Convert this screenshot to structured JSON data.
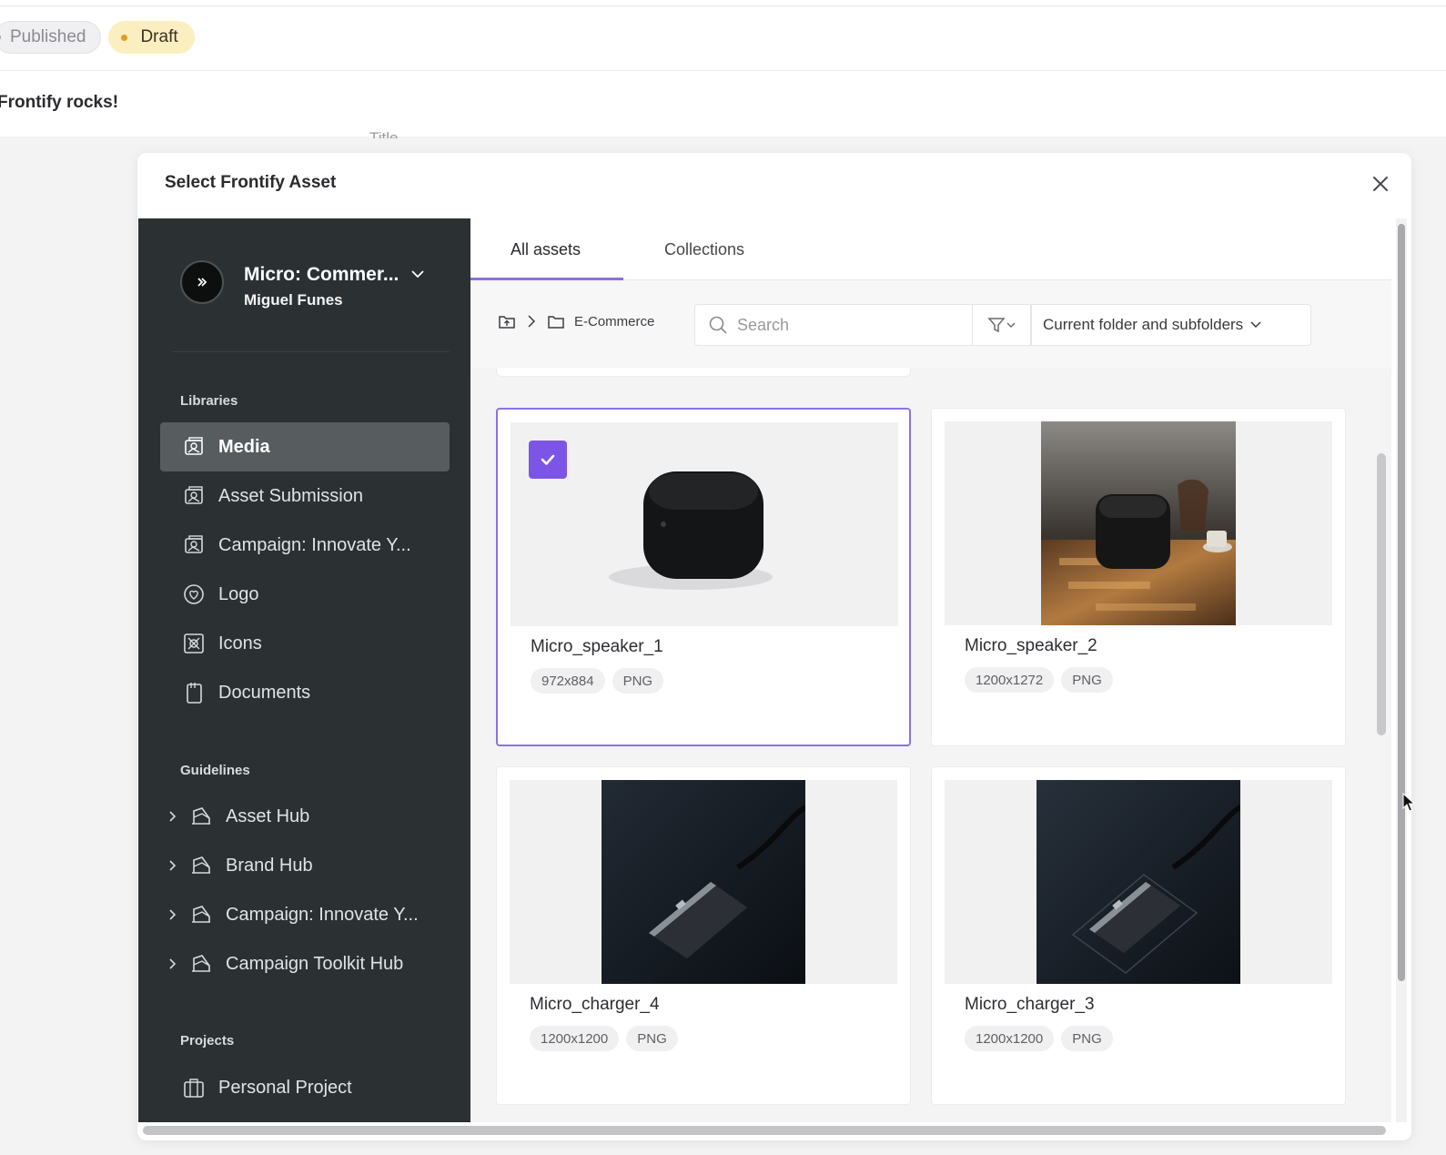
{
  "page": {
    "status_published": "Published",
    "status_draft": "Draft",
    "content_text": "Frontify rocks!",
    "field_label": "Title"
  },
  "modal": {
    "title": "Select Frontify Asset",
    "close_icon": "close-icon"
  },
  "sidebar": {
    "workspace_name": "Micro: Commer...",
    "workspace_user": "Miguel Funes",
    "libraries_heading": "Libraries",
    "libraries": [
      {
        "label": "Media",
        "icon": "media-library-icon",
        "active": true
      },
      {
        "label": "Asset Submission",
        "icon": "media-library-icon"
      },
      {
        "label": "Campaign: Innovate Y...",
        "icon": "media-library-icon"
      },
      {
        "label": "Logo",
        "icon": "logo-library-icon"
      },
      {
        "label": "Icons",
        "icon": "icons-library-icon"
      },
      {
        "label": "Documents",
        "icon": "documents-library-icon"
      }
    ],
    "guidelines_heading": "Guidelines",
    "guidelines": [
      {
        "label": "Asset Hub",
        "icon": "guideline-icon"
      },
      {
        "label": "Brand Hub",
        "icon": "guideline-icon"
      },
      {
        "label": "Campaign: Innovate Y...",
        "icon": "guideline-icon"
      },
      {
        "label": "Campaign Toolkit Hub",
        "icon": "guideline-icon"
      }
    ],
    "projects_heading": "Projects",
    "projects": [
      {
        "label": "Personal Project",
        "icon": "project-icon"
      }
    ]
  },
  "tabs": [
    {
      "label": "All assets",
      "active": true
    },
    {
      "label": "Collections",
      "active": false
    }
  ],
  "toolbar": {
    "breadcrumb_folder": "E-Commerce",
    "search_placeholder": "Search",
    "scope": "Current folder and subfolders"
  },
  "assets": [
    {
      "name": "Micro_speaker_1",
      "dims": "972x884",
      "format": "PNG",
      "selected": true
    },
    {
      "name": "Micro_speaker_2",
      "dims": "1200x1272",
      "format": "PNG",
      "selected": false
    },
    {
      "name": "Micro_charger_4",
      "dims": "1200x1200",
      "format": "PNG",
      "selected": false
    },
    {
      "name": "Micro_charger_3",
      "dims": "1200x1200",
      "format": "PNG",
      "selected": false
    }
  ],
  "colors": {
    "sidebar_bg": "#2b3132",
    "accent": "#7d55e6",
    "draft_pill": "#fbefc2"
  }
}
